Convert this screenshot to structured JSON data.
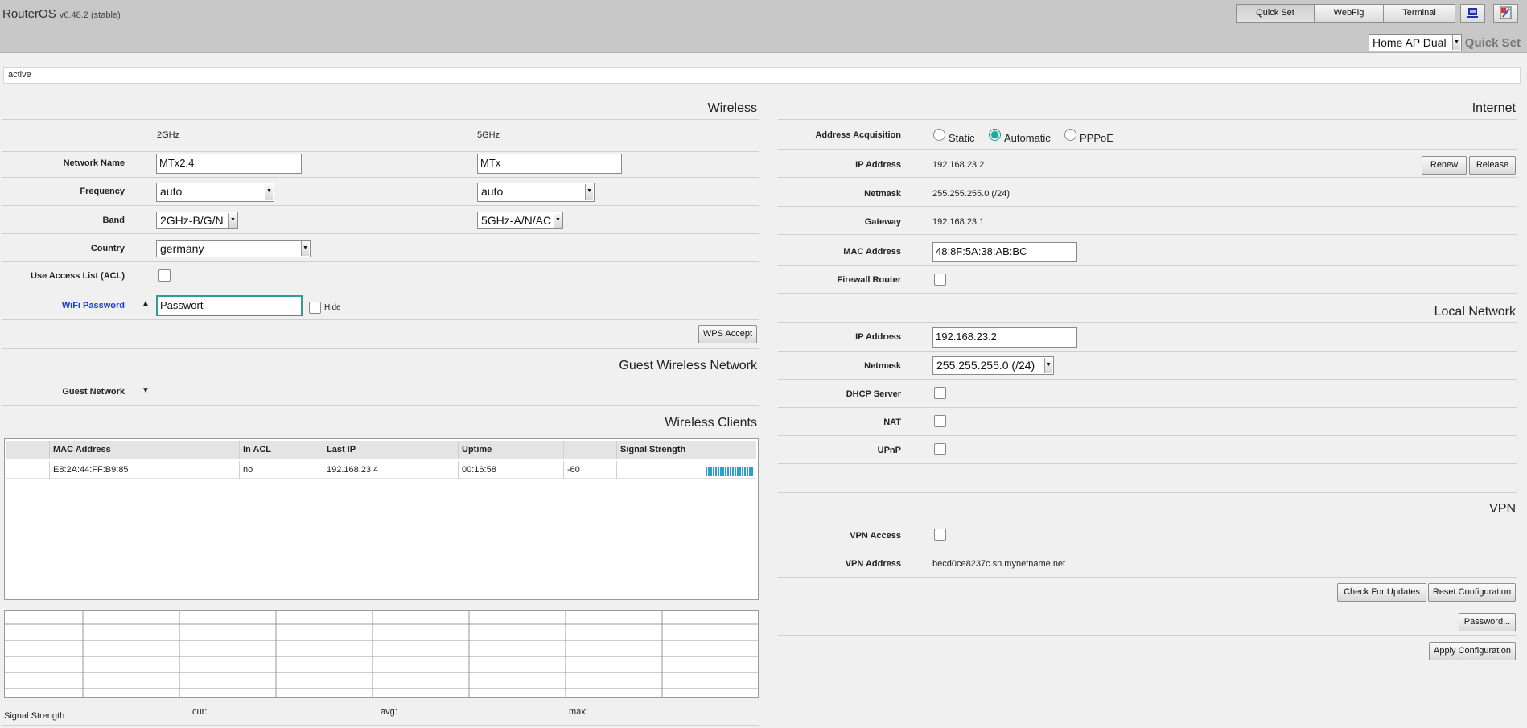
{
  "header": {
    "brand": "RouterOS",
    "version": "v6.48.2 (stable)",
    "buttons": [
      "Quick Set",
      "WebFig",
      "Terminal"
    ],
    "mode_select": "Home AP Dual",
    "title": "Quick Set"
  },
  "status": "active",
  "wireless": {
    "title": "Wireless",
    "col_2ghz": "2GHz",
    "col_5ghz": "5GHz",
    "network_name_label": "Network Name",
    "network_name_2": "MTx2.4",
    "network_name_5": "MTx",
    "frequency_label": "Frequency",
    "frequency_2": "auto",
    "frequency_5": "auto",
    "band_label": "Band",
    "band_2": "2GHz-B/G/N",
    "band_5": "5GHz-A/N/AC",
    "country_label": "Country",
    "country": "germany",
    "acl_label": "Use Access List (ACL)",
    "password_label": "WiFi Password",
    "password": "Passwort",
    "hide_label": "Hide",
    "wps_button": "WPS Accept"
  },
  "guest": {
    "title": "Guest Wireless Network",
    "label": "Guest Network"
  },
  "clients": {
    "title": "Wireless Clients",
    "columns": [
      "",
      "MAC Address",
      "In ACL",
      "Last IP",
      "Uptime",
      "",
      "Signal Strength"
    ],
    "rows": [
      {
        "mac": "E8:2A:44:FF:B9:85",
        "in_acl": "no",
        "last_ip": "192.168.23.4",
        "uptime": "00:16:58",
        "signal": "-60",
        "signal_level": 1.0
      }
    ]
  },
  "signal": {
    "label": "Signal Strength",
    "cur": "cur:",
    "avg": "avg:",
    "max": "max:"
  },
  "internet": {
    "title": "Internet",
    "acq_label": "Address Acquisition",
    "acq_options": [
      "Static",
      "Automatic",
      "PPPoE"
    ],
    "acq_selected": "Automatic",
    "ip_label": "IP Address",
    "ip": "192.168.23.2",
    "renew_button": "Renew",
    "release_button": "Release",
    "netmask_label": "Netmask",
    "netmask": "255.255.255.0 (/24)",
    "gateway_label": "Gateway",
    "gateway": "192.168.23.1",
    "mac_label": "MAC Address",
    "mac": "48:8F:5A:38:AB:BC",
    "firewall_label": "Firewall Router"
  },
  "local": {
    "title": "Local Network",
    "ip_label": "IP Address",
    "ip": "192.168.23.2",
    "netmask_label": "Netmask",
    "netmask": "255.255.255.0 (/24)",
    "dhcp_label": "DHCP Server",
    "nat_label": "NAT",
    "upnp_label": "UPnP"
  },
  "vpn": {
    "title": "VPN",
    "access_label": "VPN Access",
    "address_label": "VPN Address",
    "address": "becd0ce8237c.sn.mynetname.net"
  },
  "actions": {
    "check_updates": "Check For Updates",
    "reset_config": "Reset Configuration",
    "password": "Password...",
    "apply": "Apply Configuration"
  },
  "colors": {
    "header_bg": "#c8c8c8",
    "accent": "#2f9e8f",
    "signal": "#2a9fd6",
    "label_highlight": "#1a3fd0"
  }
}
